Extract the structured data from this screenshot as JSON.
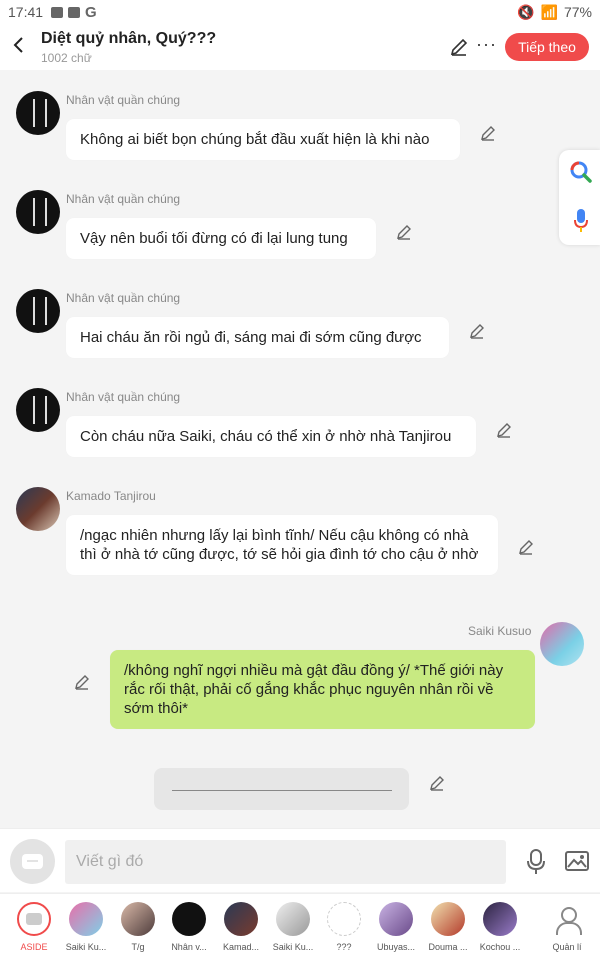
{
  "status": {
    "time": "17:41",
    "battery": "77%"
  },
  "header": {
    "title": "Diệt quỷ nhân, Quý???",
    "subtitle": "1002 chữ",
    "follow_label": "Tiếp theo",
    "back_icon": "back-arrow-icon",
    "more_icon": "more-dots-icon"
  },
  "messages": [
    {
      "sender": "Nhân vật quần chúng",
      "text": "Không ai biết bọn chúng bắt đầu xuất hiện là khi nào"
    },
    {
      "sender": "Nhân vật quần chúng",
      "text": "Vậy nên buổi tối đừng có đi lại lung tung"
    },
    {
      "sender": "Nhân vật quần chúng",
      "text": "Hai cháu ăn rồi ngủ đi, sáng mai đi sớm cũng được"
    },
    {
      "sender": "Nhân vật quần chúng",
      "text": "Còn cháu nữa Saiki, cháu có thể xin ở nhờ nhà Tanjirou"
    },
    {
      "sender": "Kamado Tanjirou",
      "text": "/ngạc nhiên nhưng lấy lại bình tĩnh/ Nếu cậu không có nhà thì ở nhà tớ cũng được, tớ sẽ hỏi gia đình tớ cho cậu ở nhờ"
    },
    {
      "sender": "Saiki Kusuo",
      "text": "/không nghĩ ngợi nhiều mà gật đầu đồng ý/ *Thế giới này rắc rối thật, phải cố gắng khắc phục nguyên nhân rồi về sớm thôi*"
    }
  ],
  "input": {
    "placeholder": "Viết gì đó"
  },
  "characters": [
    {
      "name": "ASIDE"
    },
    {
      "name": "Saiki Ku..."
    },
    {
      "name": "T/g"
    },
    {
      "name": "Nhân v..."
    },
    {
      "name": "Kamad..."
    },
    {
      "name": "Saiki Ku..."
    },
    {
      "name": "???"
    },
    {
      "name": "Ubuyas..."
    },
    {
      "name": "Douma ..."
    },
    {
      "name": "Kochou ..."
    },
    {
      "name": "Quản lí"
    }
  ],
  "colors": {
    "accent": "#f04b4b",
    "mine_bubble": "#c8ea82",
    "background": "#f4f4f4"
  }
}
